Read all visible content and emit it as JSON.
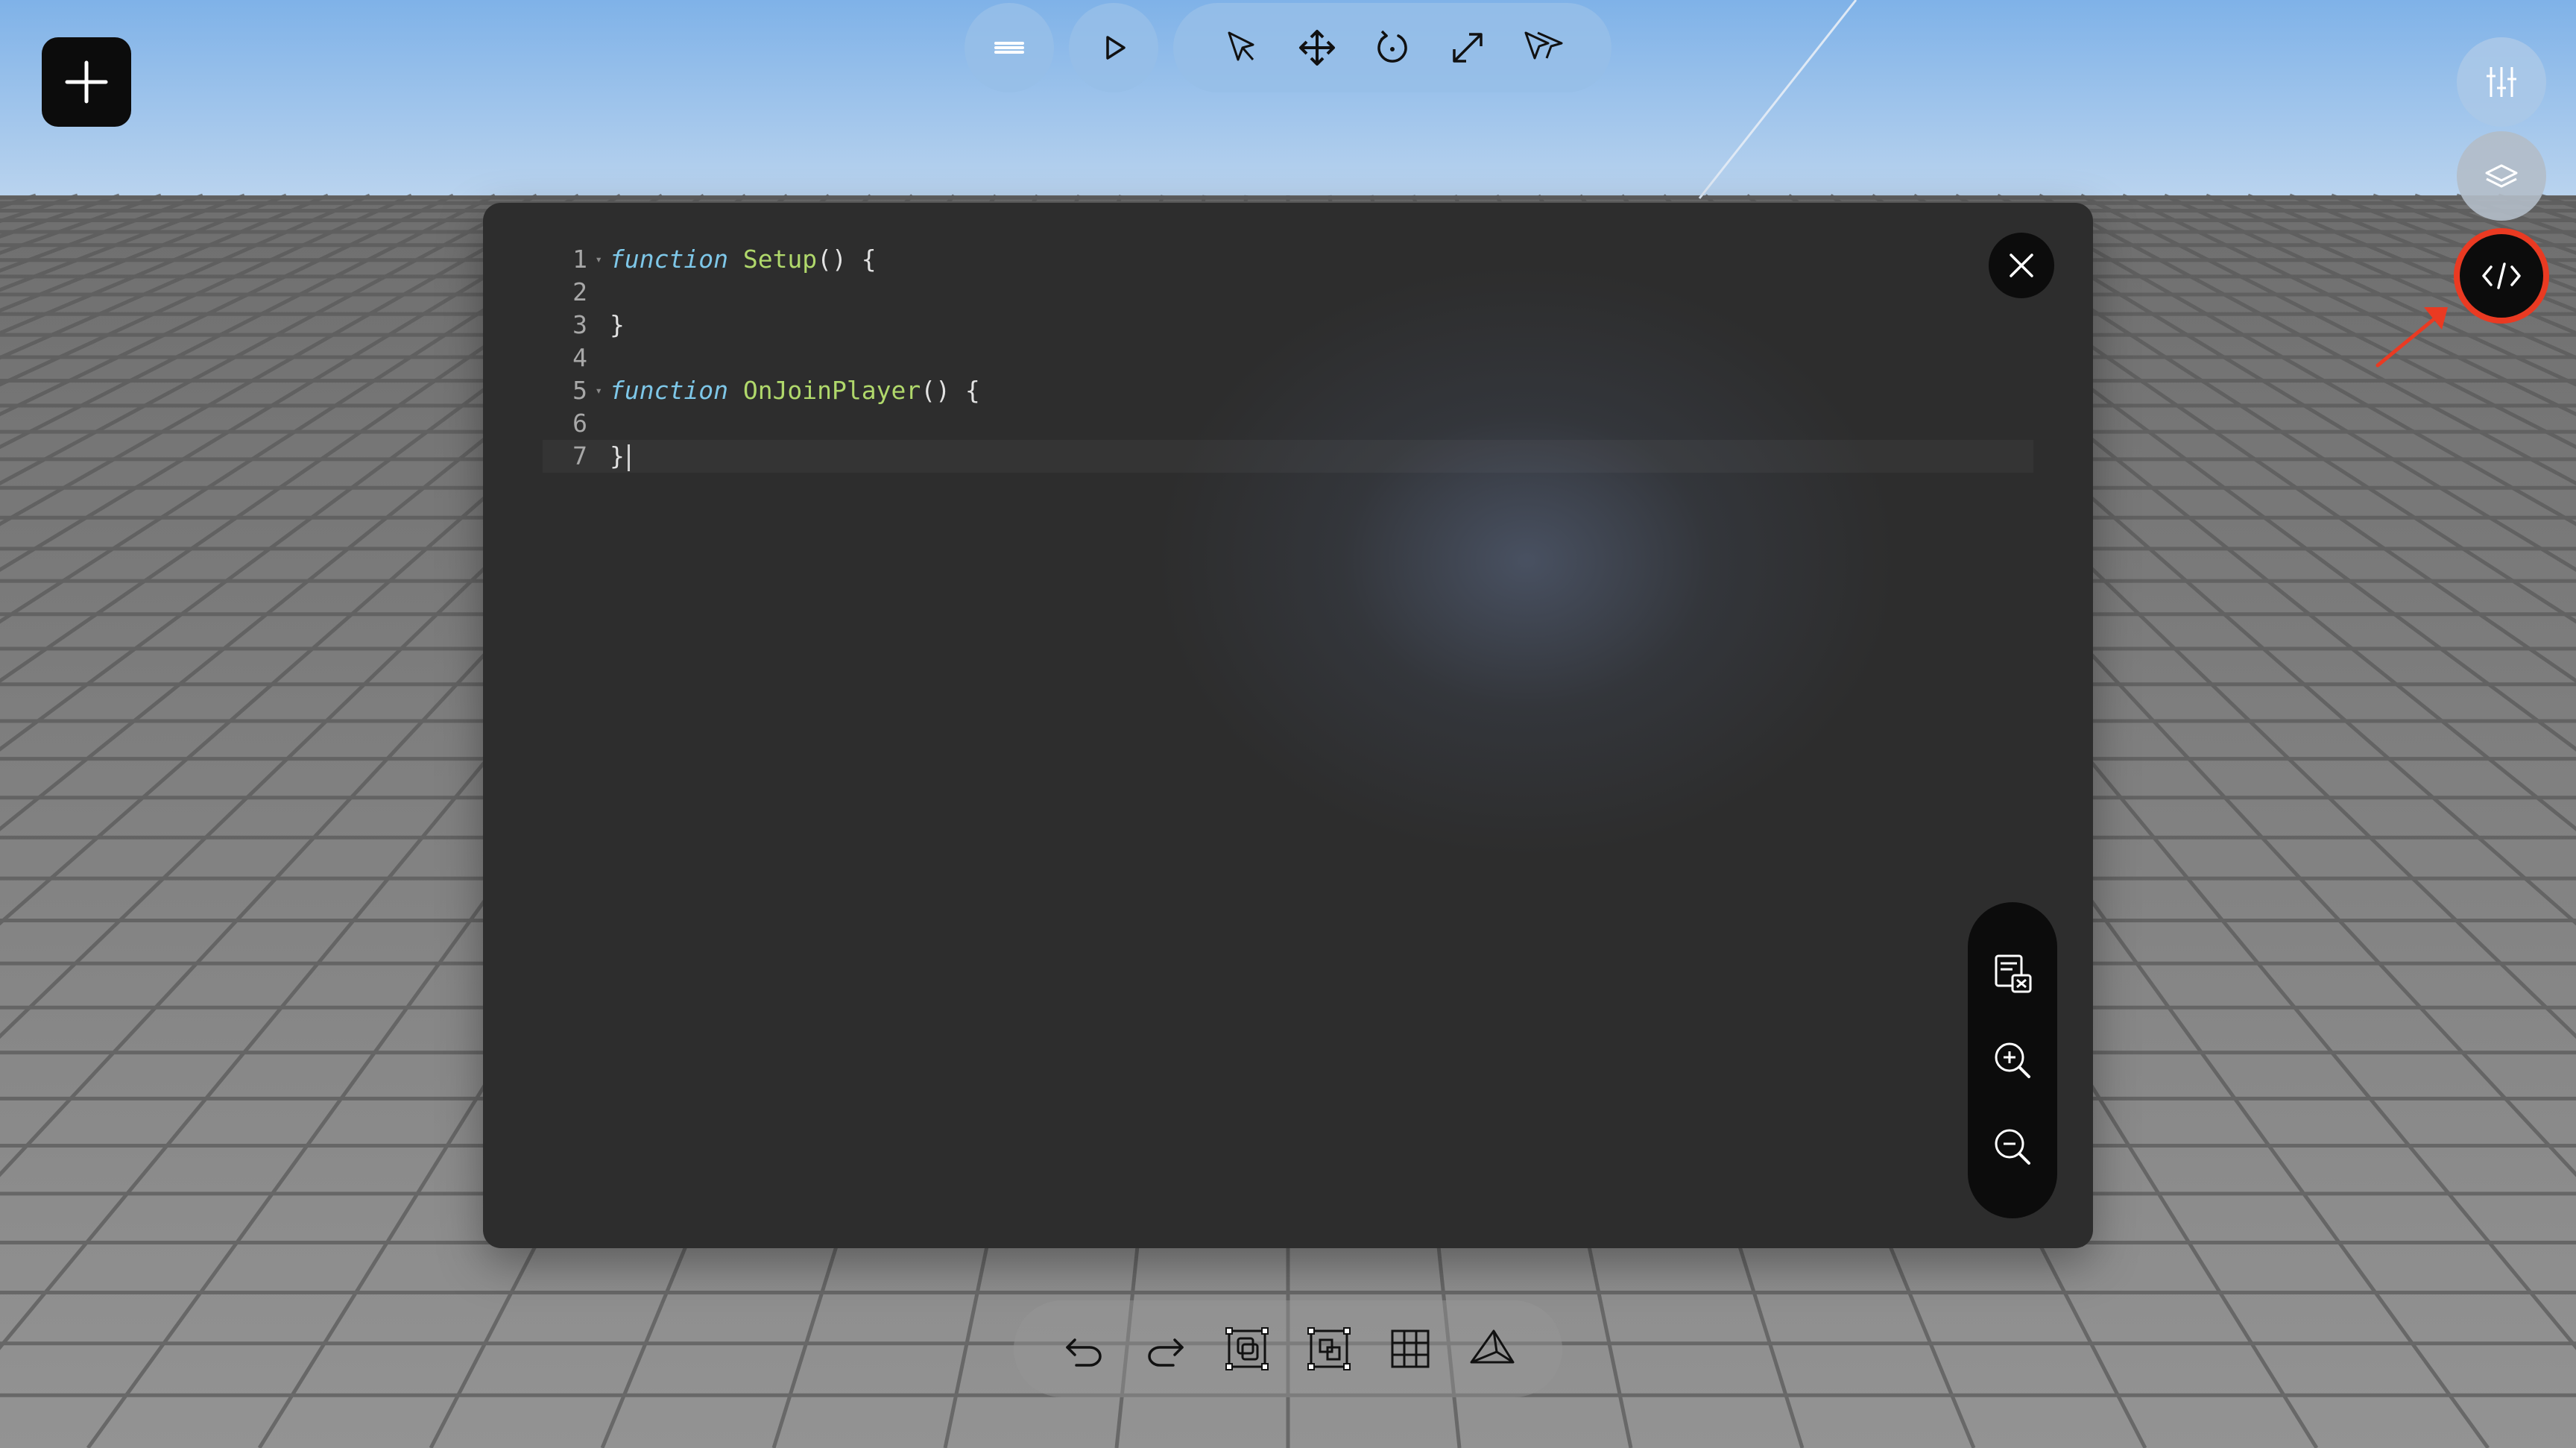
{
  "toolbar": {
    "items": [
      "menu-icon",
      "play-icon",
      "select-icon",
      "move-icon",
      "rotate-icon",
      "scale-icon",
      "multi-select-icon"
    ]
  },
  "right_rail": {
    "items": [
      "sliders-icon",
      "layers-icon",
      "code-icon"
    ],
    "active": "code-icon"
  },
  "editor": {
    "lines": [
      {
        "num": "1",
        "kw": "function",
        "fn": "Setup",
        "rest": "() {"
      },
      {
        "num": "2",
        "kw": "",
        "fn": "",
        "rest": ""
      },
      {
        "num": "3",
        "kw": "",
        "fn": "",
        "rest": "}"
      },
      {
        "num": "4",
        "kw": "",
        "fn": "",
        "rest": ""
      },
      {
        "num": "5",
        "kw": "function",
        "fn": "OnJoinPlayer",
        "rest": "() {"
      },
      {
        "num": "6",
        "kw": "",
        "fn": "",
        "rest": ""
      },
      {
        "num": "7",
        "kw": "",
        "fn": "",
        "rest": "}"
      }
    ],
    "side_tools": [
      "clear-console-icon",
      "zoom-in-icon",
      "zoom-out-icon"
    ]
  },
  "bottom_toolbar": {
    "items": [
      "undo-icon",
      "redo-icon",
      "duplicate-icon",
      "group-icon",
      "grid-icon",
      "camera-icon"
    ]
  },
  "colors": {
    "keyword": "#7ec7e8",
    "function_name": "#b0d86b",
    "highlight_ring": "#ea3a22",
    "sky": "#a6c8ee",
    "floor": "#8a8a8a"
  }
}
